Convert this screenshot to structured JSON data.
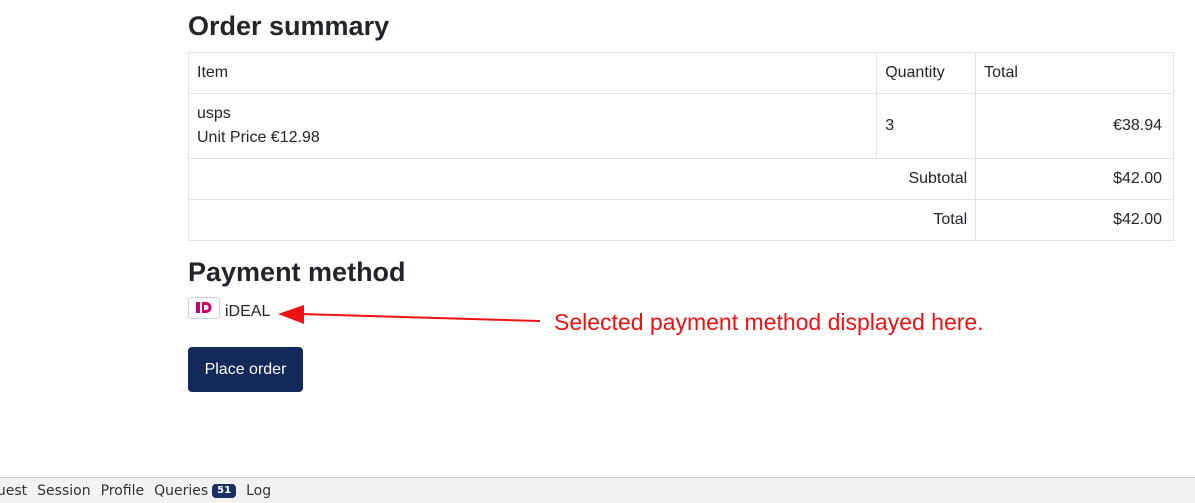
{
  "order_summary": {
    "title": "Order summary",
    "headers": {
      "item": "Item",
      "quantity": "Quantity",
      "total": "Total"
    },
    "items": [
      {
        "name": "usps",
        "unit_price": "Unit Price €12.98",
        "quantity": "3",
        "total": "€38.94"
      }
    ],
    "subtotal_label": "Subtotal",
    "subtotal_value": "$42.00",
    "total_label": "Total",
    "total_value": "$42.00"
  },
  "payment": {
    "title": "Payment method",
    "method": "iDEAL",
    "logo_text": "iD",
    "annotation": "Selected payment method displayed here.",
    "annotation_color": "#ee1111"
  },
  "actions": {
    "place_order": "Place order",
    "button_color": "#14285a"
  },
  "debug_bar": {
    "items": [
      "quest",
      "Session",
      "Profile",
      "Queries",
      "Log"
    ],
    "queries_count": "51"
  }
}
